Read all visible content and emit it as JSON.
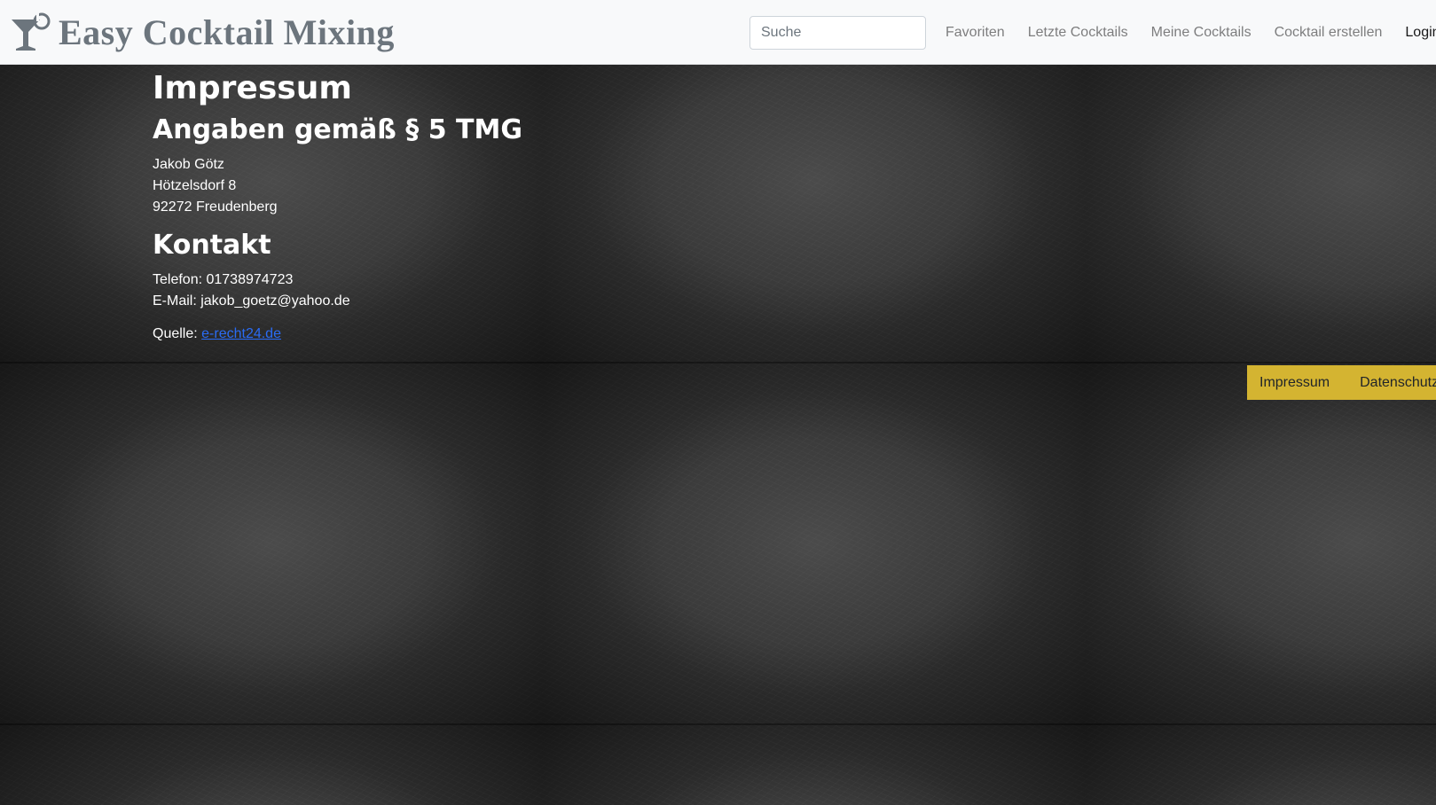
{
  "brand": {
    "title": "Easy Cocktail Mixing",
    "icon": "cocktail-glass-icon"
  },
  "search": {
    "placeholder": "Suche",
    "value": ""
  },
  "nav": {
    "items": [
      {
        "label": "Favoriten"
      },
      {
        "label": "Letzte Cocktails"
      },
      {
        "label": "Meine Cocktails"
      },
      {
        "label": "Cocktail erstellen"
      },
      {
        "label": "Login"
      }
    ]
  },
  "main": {
    "title": "Impressum",
    "section1_heading": "Angaben gemäß § 5 TMG",
    "address": {
      "name": "Jakob Götz",
      "street": "Hötzelsdorf 8",
      "city": "92272 Freudenberg"
    },
    "section2_heading": "Kontakt",
    "contact": {
      "phone": "Telefon: 01738974723",
      "email": "E-Mail: jakob_goetz@yahoo.de"
    },
    "source_label": "Quelle: ",
    "source_link": "e-recht24.de"
  },
  "footer": {
    "links": [
      {
        "label": "Impressum"
      },
      {
        "label": "Datenschutz"
      }
    ],
    "accent_color": "#d4b431"
  }
}
